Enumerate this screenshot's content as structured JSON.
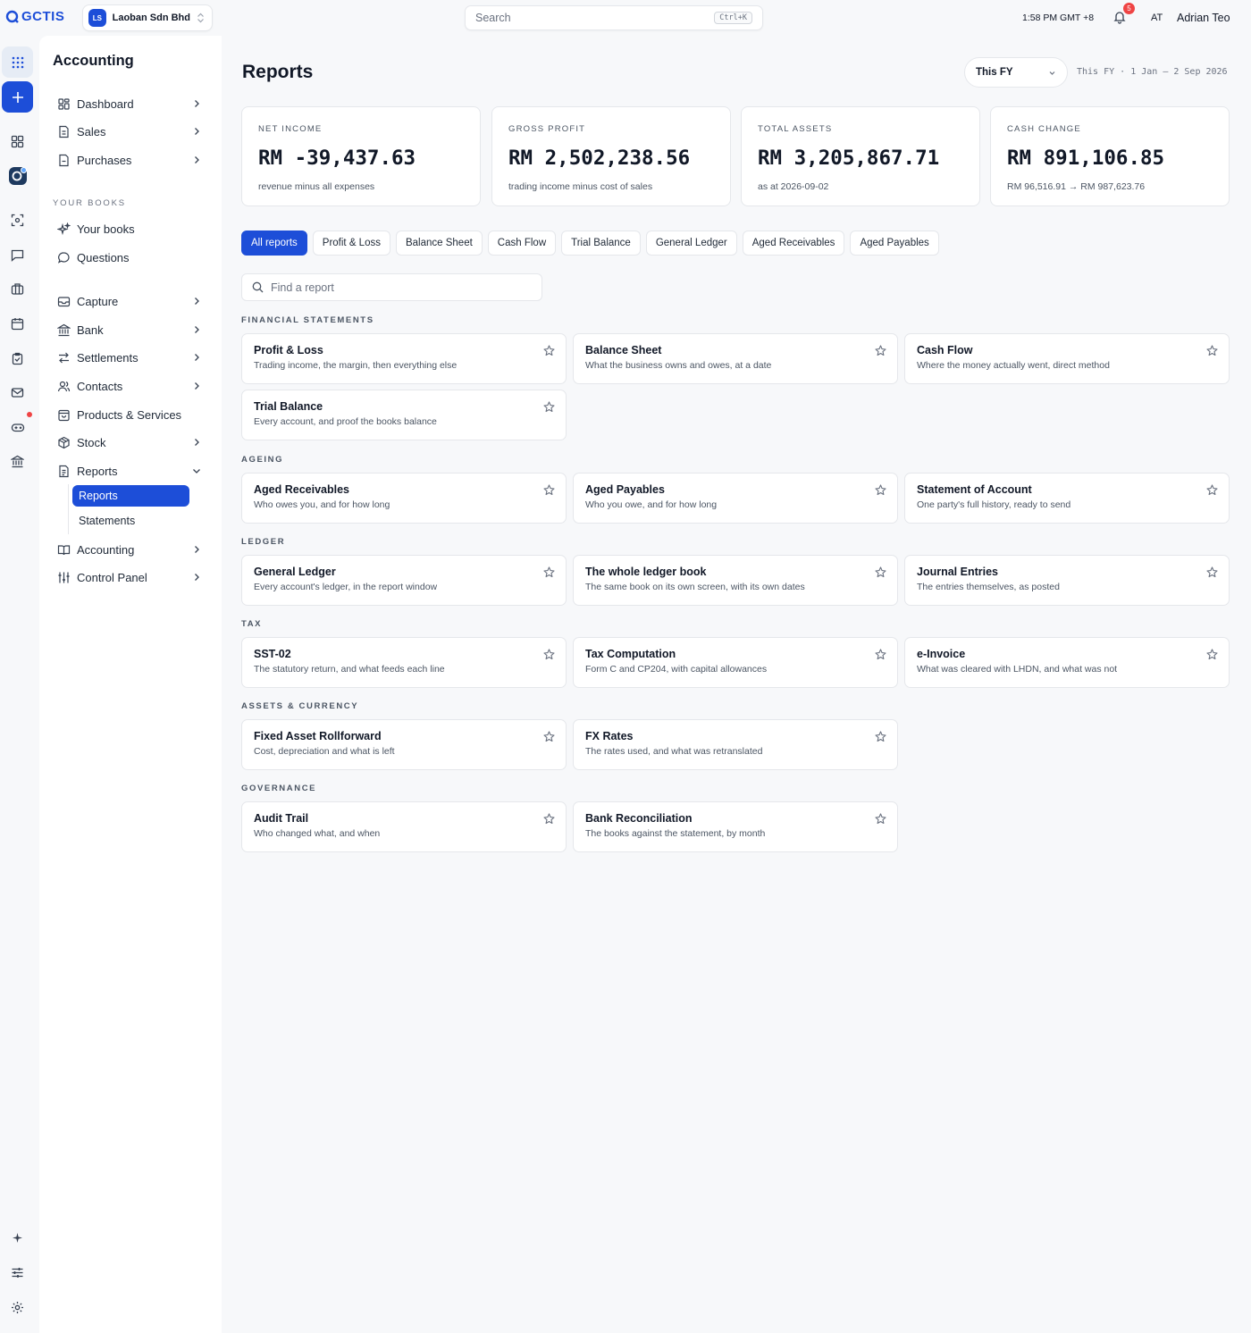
{
  "topbar": {
    "logo_text": "GCTIS",
    "company": {
      "initials": "LS",
      "name": "Laoban Sdn Bhd"
    },
    "search": {
      "placeholder": "Search",
      "shortcut": "Ctrl+K"
    },
    "time": "1:58 PM GMT +8",
    "notifications_count": "5",
    "user_initials": "AT",
    "user_name": "Adrian Teo"
  },
  "rail": {
    "icons": [
      "apps-grid-icon",
      "plus-icon",
      "dashboard-icon",
      "books-icon",
      "scan-icon",
      "chat-icon",
      "briefcase-icon",
      "calendar-icon",
      "clipboard-icon",
      "mail-icon",
      "gamepad-icon",
      "bank-icon",
      "sparkle-icon",
      "sliders-icon",
      "gear-icon"
    ]
  },
  "sidebar": {
    "title": "Accounting",
    "section_your_books": "YOUR BOOKS",
    "items": {
      "dashboard": "Dashboard",
      "sales": "Sales",
      "purchases": "Purchases",
      "your_books": "Your books",
      "questions": "Questions",
      "capture": "Capture",
      "bank": "Bank",
      "settlements": "Settlements",
      "contacts": "Contacts",
      "products": "Products & Services",
      "stock": "Stock",
      "reports": "Reports",
      "reports_sub": "Reports",
      "statements_sub": "Statements",
      "accounting": "Accounting",
      "control_panel": "Control Panel"
    }
  },
  "main": {
    "title": "Reports",
    "period_select": "This FY",
    "period_range": "This FY · 1 Jan – 2 Sep 2026",
    "kpis": [
      {
        "label": "NET INCOME",
        "value": "RM -39,437.63",
        "sub": "revenue minus all expenses"
      },
      {
        "label": "GROSS PROFIT",
        "value": "RM 2,502,238.56",
        "sub": "trading income minus cost of sales"
      },
      {
        "label": "TOTAL ASSETS",
        "value": "RM 3,205,867.71",
        "sub": "as at 2026-09-02"
      },
      {
        "label": "CASH CHANGE",
        "value": "RM 891,106.85",
        "sub": "RM 96,516.91 → RM 987,623.76"
      }
    ],
    "tabs": [
      "All reports",
      "Profit & Loss",
      "Balance Sheet",
      "Cash Flow",
      "Trial Balance",
      "General Ledger",
      "Aged Receivables",
      "Aged Payables"
    ],
    "find_placeholder": "Find a report",
    "sections": {
      "financial": {
        "label": "FINANCIAL STATEMENTS",
        "cards": [
          {
            "title": "Profit & Loss",
            "desc": "Trading income, the margin, then everything else"
          },
          {
            "title": "Balance Sheet",
            "desc": "What the business owns and owes, at a date"
          },
          {
            "title": "Cash Flow",
            "desc": "Where the money actually went, direct method"
          },
          {
            "title": "Trial Balance",
            "desc": "Every account, and proof the books balance"
          }
        ]
      },
      "ageing": {
        "label": "AGEING",
        "cards": [
          {
            "title": "Aged Receivables",
            "desc": "Who owes you, and for how long"
          },
          {
            "title": "Aged Payables",
            "desc": "Who you owe, and for how long"
          },
          {
            "title": "Statement of Account",
            "desc": "One party's full history, ready to send"
          }
        ]
      },
      "ledger": {
        "label": "LEDGER",
        "cards": [
          {
            "title": "General Ledger",
            "desc": "Every account's ledger, in the report window"
          },
          {
            "title": "The whole ledger book",
            "desc": "The same book on its own screen, with its own dates"
          },
          {
            "title": "Journal Entries",
            "desc": "The entries themselves, as posted"
          }
        ]
      },
      "tax": {
        "label": "TAX",
        "cards": [
          {
            "title": "SST-02",
            "desc": "The statutory return, and what feeds each line"
          },
          {
            "title": "Tax Computation",
            "desc": "Form C and CP204, with capital allowances"
          },
          {
            "title": "e-Invoice",
            "desc": "What was cleared with LHDN, and what was not"
          }
        ]
      },
      "assets": {
        "label": "ASSETS & CURRENCY",
        "cards": [
          {
            "title": "Fixed Asset Rollforward",
            "desc": "Cost, depreciation and what is left"
          },
          {
            "title": "FX Rates",
            "desc": "The rates used, and what was retranslated"
          }
        ]
      },
      "governance": {
        "label": "GOVERNANCE",
        "cards": [
          {
            "title": "Audit Trail",
            "desc": "Who changed what, and when"
          },
          {
            "title": "Bank Reconciliation",
            "desc": "The books against the statement, by month"
          }
        ]
      }
    }
  }
}
